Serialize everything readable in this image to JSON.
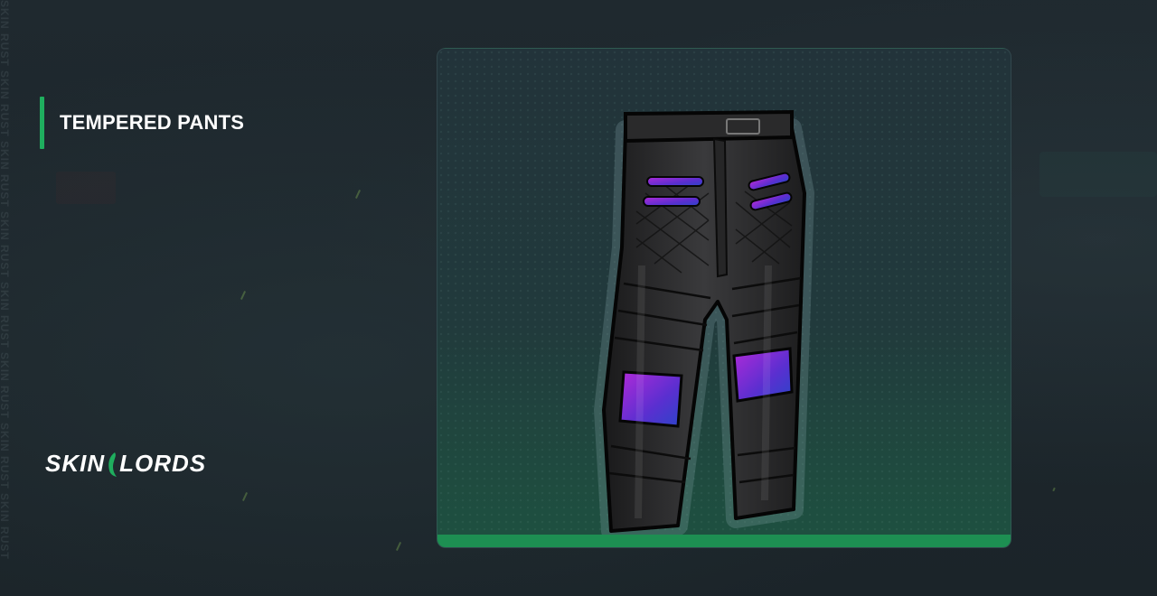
{
  "item": {
    "name": "TEMPERED PANTS"
  },
  "brand": {
    "logo_text_left": "SKIN",
    "logo_text_right": "LORDS",
    "edge_watermark": "SKIN RUST SKIN RUST SKIN RUST SKIN RUST SKIN RUST SKIN RUST SKIN RUST SKIN RUST"
  },
  "icons": {
    "item_image": "leather-pants-icon",
    "logo_mark": "horn-logo-icon"
  },
  "colors": {
    "accent": "#1fae5e",
    "card_bar": "#1d8f52",
    "background": "#1c252b"
  }
}
